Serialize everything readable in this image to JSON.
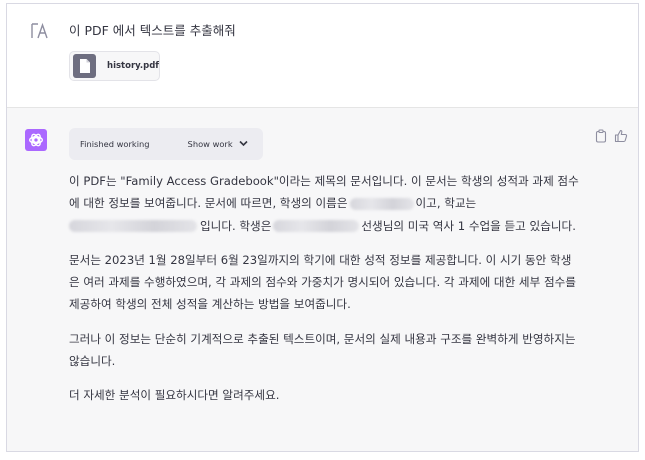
{
  "user_message": {
    "text": "이 PDF 에서 텍스트를 추출해줘",
    "attachment": {
      "name": "history.pdf",
      "icon": "file-icon"
    }
  },
  "assistant": {
    "status": {
      "label": "Finished working",
      "toggle": "Show work"
    },
    "actions": [
      "copy-icon",
      "thumbs-up-icon"
    ],
    "p1": {
      "a": "이 PDF는 \"Family Access Gradebook\"이라는 제목의 문서입니다. 이 문서는 학생의 성적과 과제 점수에 대한 정보를 보여줍니다. 문서에 따르면, 학생의 이름은",
      "b": "이고, 학교는",
      "c": "입니다. 학생은",
      "d": "선생님의 미국 역사 1 수업을 듣고 있습니다."
    },
    "p2": "문서는 2023년 1월 28일부터 6월 23일까지의 학기에 대한 성적 정보를 제공합니다. 이 시기 동안 학생은 여러 과제를 수행하였으며, 각 과제의 점수와 가중치가 명시되어 있습니다. 각 과제에 대한 세부 점수를 제공하여 학생의 전체 성적을 계산하는 방법을 보여줍니다.",
    "p3": "그러나 이 정보는 단순히 기계적으로 추출된 텍스트이며, 문서의 실제 내용과 구조를 완벽하게 반영하지는 않습니다.",
    "p4": "더 자세한 분석이 필요하시다면 알려주세요."
  },
  "colors": {
    "gpt_accent": "#ab68ff",
    "file_icon_bg": "#6e6e80",
    "assistant_bg": "#f7f7f8"
  }
}
